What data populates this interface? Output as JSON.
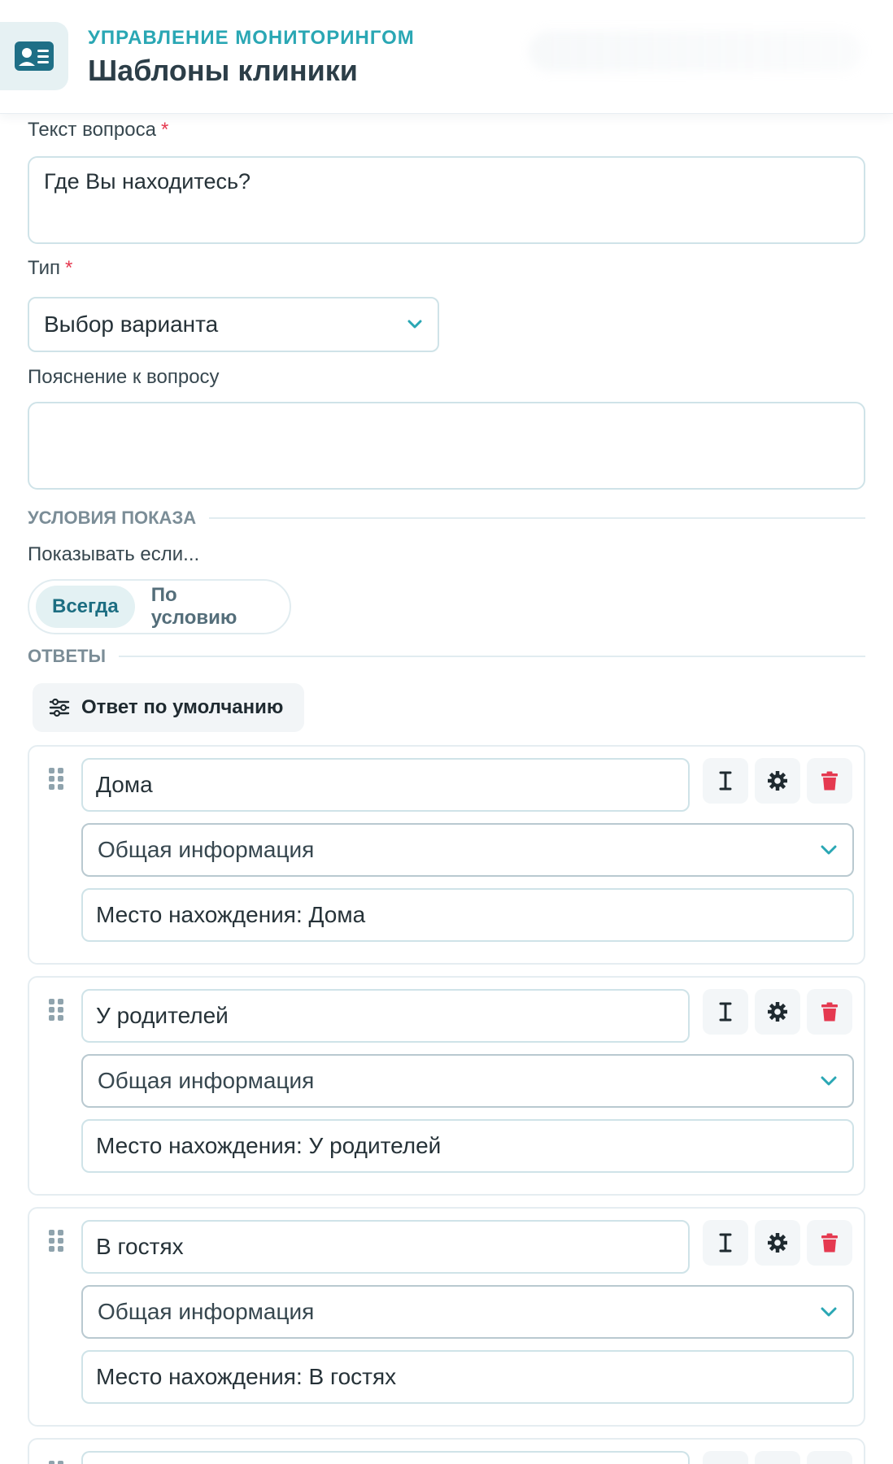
{
  "header": {
    "eyebrow": "Управление мониторингом",
    "title": "Шаблоны клиники",
    "icon": "contact-card-icon"
  },
  "form": {
    "question_text": {
      "label": "Текст вопроса",
      "required_mark": "*",
      "value": "Где Вы находитесь?"
    },
    "type": {
      "label": "Тип",
      "required_mark": "*",
      "value": "Выбор варианта"
    },
    "hint": {
      "label": "Пояснение к вопросу",
      "value": ""
    }
  },
  "conditions": {
    "section_title": "Условия показа",
    "show_if_label": "Показывать если...",
    "options": [
      "Всегда",
      "По условию"
    ],
    "selected": "Всегда"
  },
  "answers": {
    "section_title": "Ответы",
    "default_button": "Ответ по умолчанию",
    "items": [
      {
        "value": "Дома",
        "category": "Общая информация",
        "text": "Место нахождения: Дома"
      },
      {
        "value": "У родителей",
        "category": "Общая информация",
        "text": "Место нахождения: У родителей"
      },
      {
        "value": "В гостях",
        "category": "Общая информация",
        "text": "Место нахождения: В гостях"
      }
    ]
  },
  "colors": {
    "accent": "#2aa7b4",
    "danger": "#e53950",
    "border": "#cfe3e8"
  }
}
